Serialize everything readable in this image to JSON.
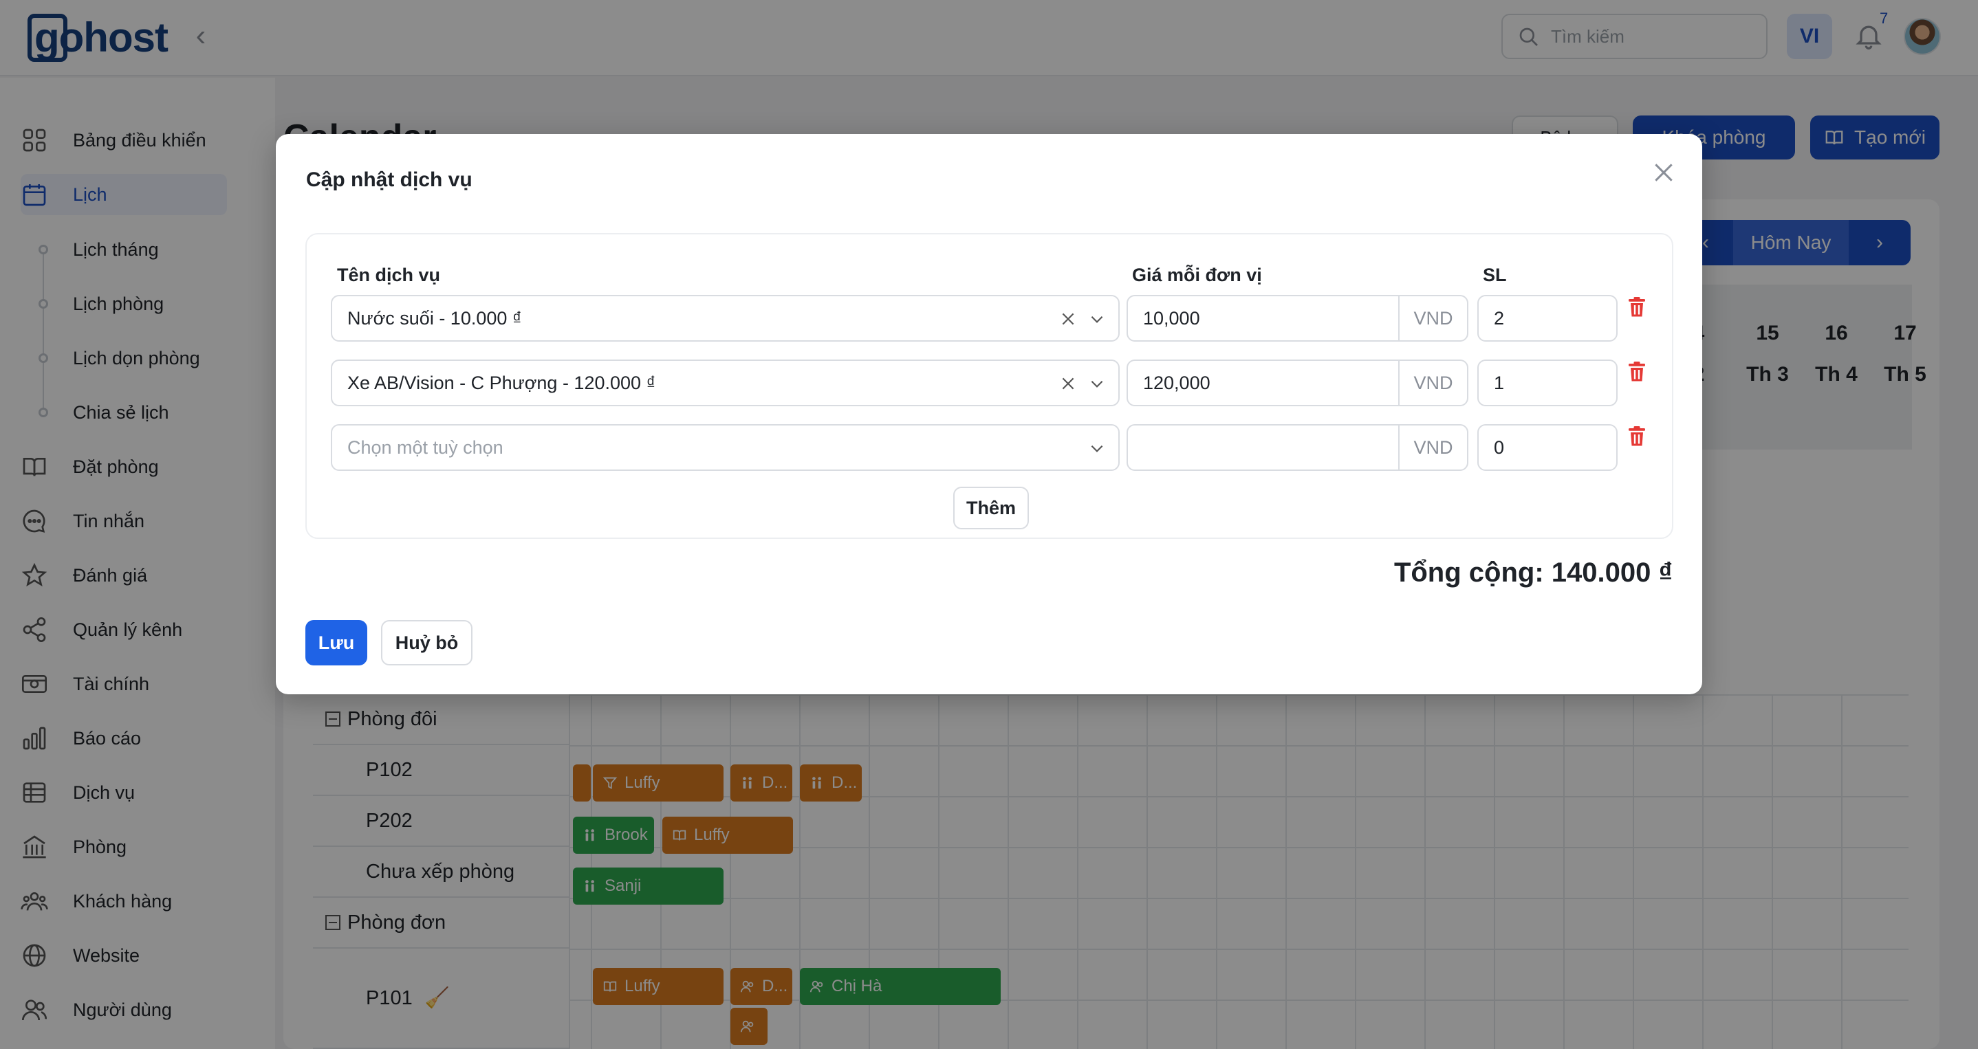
{
  "app": {
    "logo_text": "gohost",
    "search_placeholder": "Tìm kiếm",
    "language": "VI",
    "notification_count": "7"
  },
  "sidebar": {
    "items": [
      {
        "label": "Bảng điều khiển",
        "icon": "dashboard-icon"
      },
      {
        "label": "Lịch",
        "icon": "calendar-icon",
        "active": true
      },
      {
        "label": "Đặt phòng",
        "icon": "book-icon"
      },
      {
        "label": "Tin nhắn",
        "icon": "message-icon"
      },
      {
        "label": "Đánh giá",
        "icon": "star-icon"
      },
      {
        "label": "Quản lý kênh",
        "icon": "share-icon"
      },
      {
        "label": "Tài chính",
        "icon": "money-icon"
      },
      {
        "label": "Báo cáo",
        "icon": "chart-icon"
      },
      {
        "label": "Dịch vụ",
        "icon": "list-icon"
      },
      {
        "label": "Phòng",
        "icon": "building-icon"
      },
      {
        "label": "Khách hàng",
        "icon": "group-icon"
      },
      {
        "label": "Website",
        "icon": "globe-icon"
      },
      {
        "label": "Người dùng",
        "icon": "users-icon"
      }
    ],
    "sub_items": [
      "Lịch tháng",
      "Lịch phòng",
      "Lịch dọn phòng",
      "Chia sẻ lịch"
    ]
  },
  "page": {
    "title": "Calendar",
    "filter_label": "Bộ lọc",
    "lock_label": "Khóa phòng",
    "new_label": "Tạo mới",
    "today_label": "Hôm Nay",
    "days": [
      {
        "num": "4",
        "dow": "2"
      },
      {
        "num": "15",
        "dow": "Th 3"
      },
      {
        "num": "16",
        "dow": "Th 4"
      },
      {
        "num": "17",
        "dow": "Th 5"
      }
    ]
  },
  "rooms": [
    {
      "type": "group",
      "label": "Phòng đôi"
    },
    {
      "type": "room",
      "label": "P102"
    },
    {
      "type": "room",
      "label": "P202"
    },
    {
      "type": "room",
      "label": "Chưa xếp phòng"
    },
    {
      "type": "group",
      "label": "Phòng đơn"
    },
    {
      "type": "room",
      "label": "P101"
    }
  ],
  "bookings": [
    "Luffy",
    "D...",
    "D...",
    "Brook",
    "Luffy",
    "Sanji",
    "Luffy",
    "D...",
    "Chị Hà"
  ],
  "modal": {
    "title": "Cập nhật dịch vụ",
    "col_service": "Tên dịch vụ",
    "col_price": "Giá mỗi đơn vị",
    "col_qty": "SL",
    "rows": [
      {
        "service": "Nước suối - 10.000 ₫",
        "price": "10,000",
        "unit": "VND",
        "qty": "2"
      },
      {
        "service": "Xe AB/Vision - C Phượng - 120.000 ₫",
        "price": "120,000",
        "unit": "VND",
        "qty": "1"
      },
      {
        "service_placeholder": "Chọn một tuỳ chọn",
        "price": "",
        "unit": "VND",
        "qty": "0"
      }
    ],
    "add_label": "Thêm",
    "total": "Tổng cộng: 140.000 ₫",
    "save_label": "Lưu",
    "cancel_label": "Huỷ bỏ"
  },
  "colors": {
    "primary": "#1f63e6",
    "brand": "#16407f",
    "booking_orange": "#d97a1f",
    "booking_green": "#2fa84f",
    "delete_red": "#e53935"
  }
}
